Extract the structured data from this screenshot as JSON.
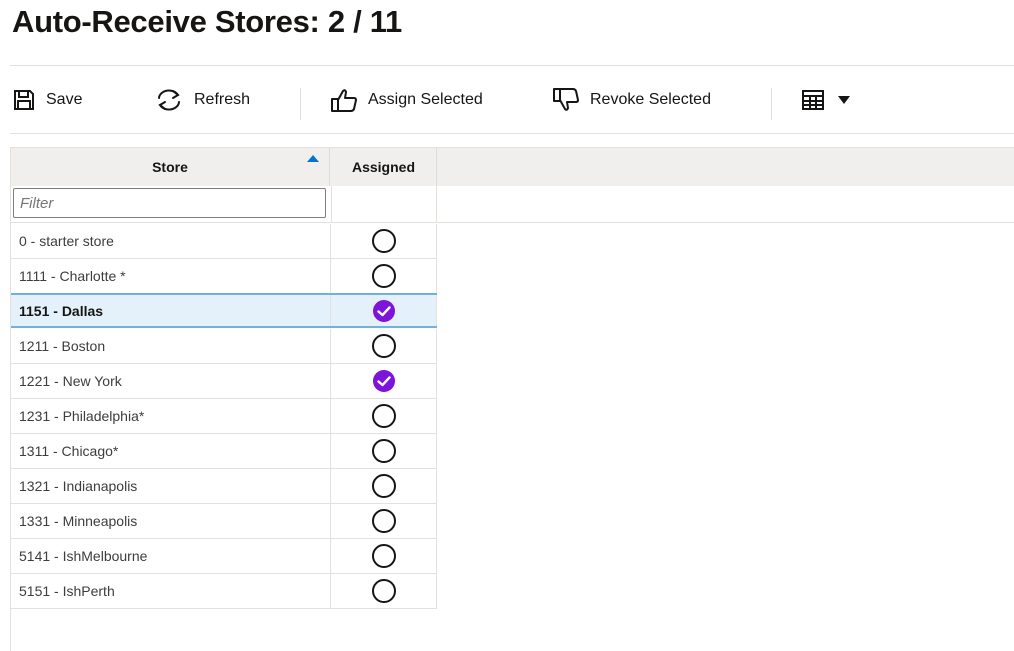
{
  "page": {
    "title": "Auto-Receive Stores: 2 / 11"
  },
  "toolbar": {
    "save_label": "Save",
    "refresh_label": "Refresh",
    "assign_label": "Assign Selected",
    "revoke_label": "Revoke Selected",
    "icons": [
      "save-icon",
      "refresh-icon",
      "thumbs-up-icon",
      "thumbs-down-icon",
      "table-view-icon",
      "caret-down-icon"
    ]
  },
  "grid": {
    "columns": {
      "store": "Store",
      "assigned": "Assigned"
    },
    "sort": {
      "column": "store",
      "direction": "ascending"
    },
    "filter": {
      "placeholder": "Filter",
      "value": ""
    },
    "rows": [
      {
        "store": "0 - starter store",
        "assigned": false,
        "selected": false
      },
      {
        "store": "1111 - Charlotte *",
        "assigned": false,
        "selected": false
      },
      {
        "store": "1151 - Dallas",
        "assigned": true,
        "selected": true
      },
      {
        "store": "1211 - Boston",
        "assigned": false,
        "selected": false
      },
      {
        "store": "1221 - New York",
        "assigned": true,
        "selected": false
      },
      {
        "store": "1231 - Philadelphia*",
        "assigned": false,
        "selected": false
      },
      {
        "store": "1311 - Chicago*",
        "assigned": false,
        "selected": false
      },
      {
        "store": "1321 - Indianapolis",
        "assigned": false,
        "selected": false
      },
      {
        "store": "1331 - Minneapolis",
        "assigned": false,
        "selected": false
      },
      {
        "store": "5141 - IshMelbourne",
        "assigned": false,
        "selected": false
      },
      {
        "store": "5151 - IshPerth",
        "assigned": false,
        "selected": false
      }
    ]
  },
  "colors": {
    "check": "#7c14d9",
    "sort_indicator": "#0572ce",
    "selected_row_bg": "#e4f1fa",
    "selected_row_border": "#6fb2e0"
  }
}
